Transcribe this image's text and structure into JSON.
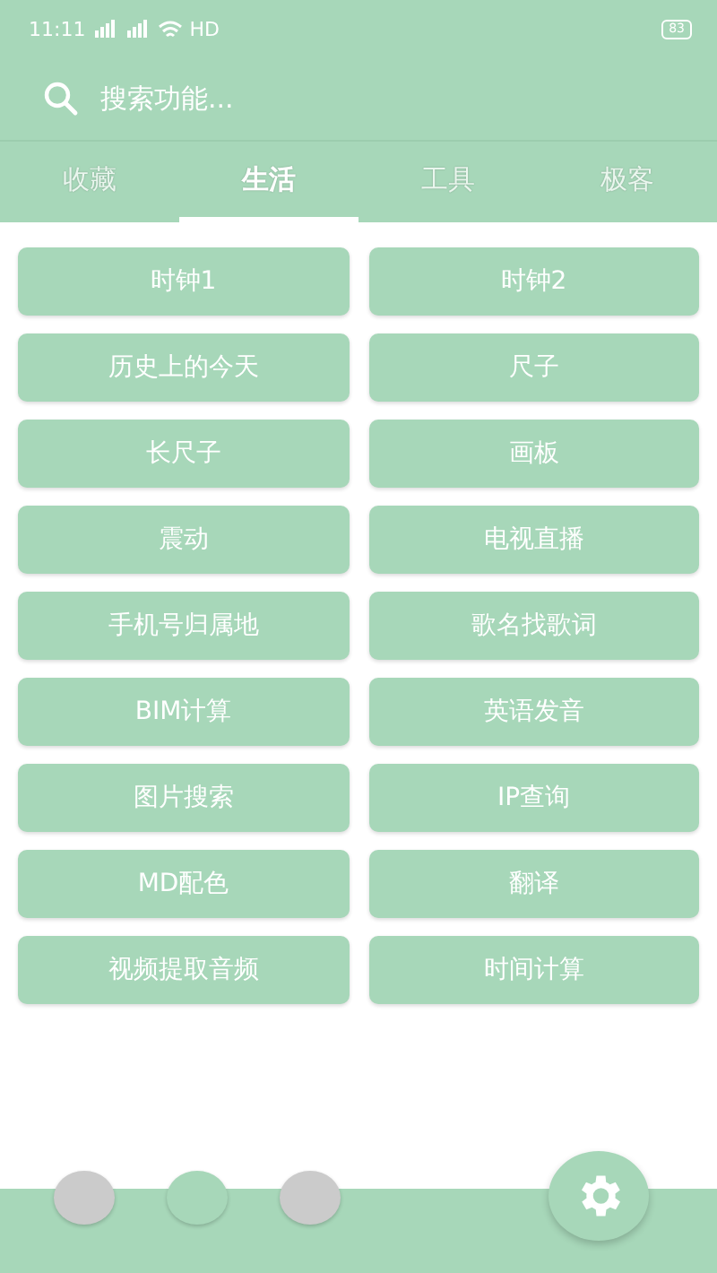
{
  "status_bar": {
    "time": "11:11",
    "network": "HD",
    "battery": "83"
  },
  "search": {
    "placeholder": "搜索功能..."
  },
  "tabs": [
    {
      "label": "收藏",
      "selected": false
    },
    {
      "label": "生活",
      "selected": true
    },
    {
      "label": "工具",
      "selected": false
    },
    {
      "label": "极客",
      "selected": false
    }
  ],
  "buttons": [
    "时钟1",
    "时钟2",
    "历史上的今天",
    "尺子",
    "长尺子",
    "画板",
    "震动",
    "电视直播",
    "手机号归属地",
    "歌名找歌词",
    "BIM计算",
    "英语发音",
    "图片搜索",
    "IP查询",
    "MD配色",
    "翻译",
    "视频提取音频",
    "时间计算"
  ],
  "page_dots": [
    {
      "selected": false
    },
    {
      "selected": true
    },
    {
      "selected": false
    }
  ]
}
